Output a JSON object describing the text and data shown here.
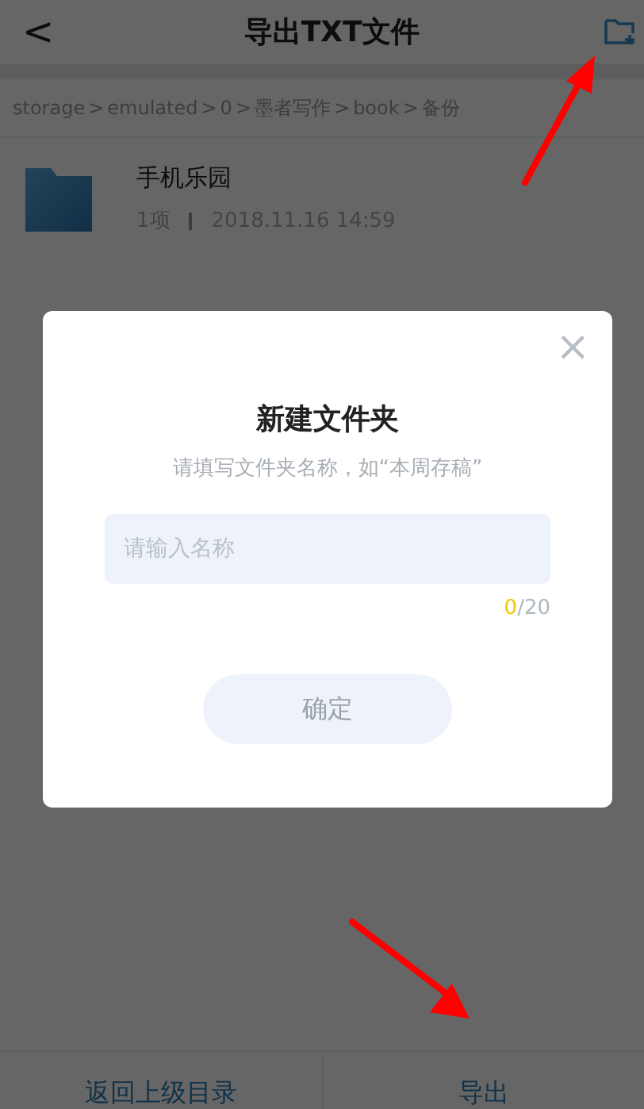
{
  "header": {
    "back": "<",
    "title": "导出TXT文件"
  },
  "breadcrumb": [
    {
      "label": "storage"
    },
    {
      "label": "emulated"
    },
    {
      "label": "0"
    },
    {
      "label": "墨者写作"
    },
    {
      "label": "book"
    },
    {
      "label": "备份"
    }
  ],
  "breadcrumb_separator": ">",
  "files": [
    {
      "name": "手机乐园",
      "count": "1项",
      "date": "2018.11.16 14:59"
    }
  ],
  "bottom_bar": [
    "返回上级目录",
    "导出"
  ],
  "dialog": {
    "close": "×",
    "title": "新建文件夹",
    "hint": "请填写文件夹名称，如“本周存稿”",
    "input": {
      "placeholder": "请输入名称"
    },
    "counter": {
      "count": "0",
      "limit": "/20"
    },
    "confirm": {
      "label": "确定",
      "disabled": true
    }
  }
}
